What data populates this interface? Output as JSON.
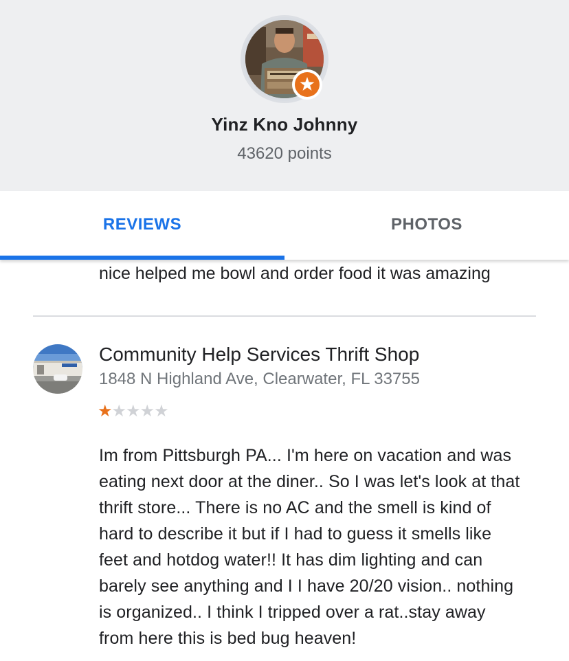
{
  "profile": {
    "name": "Yinz Kno Johnny",
    "points": "43620 points",
    "badge_icon": "local-guide-star-icon",
    "accent": "#e8711b"
  },
  "tabs": {
    "reviews_label": "REVIEWS",
    "photos_label": "PHOTOS",
    "active": "REVIEWS",
    "active_color": "#1a73e8"
  },
  "previous_review": {
    "text_tail": "nice helped me bowl and order food it was amazing"
  },
  "review": {
    "place_name": "Community Help Services Thrift Shop",
    "address": "1848 N Highland Ave, Clearwater, FL 33755",
    "rating": 1,
    "rating_max": 5,
    "text": "Im from Pittsburgh PA... I'm here on vacation and was\neating next door at the diner.. So I was let's look at that\nthrift store...  There is no AC and  the smell is kind of\nhard to describe it but if I had to guess it smells like\nfeet and hotdog water!! It has dim lighting and can\nbarely see anything and I I have 20/20 vision.. nothing\nis organized..  I think I tripped over a rat..stay away\nfrom here this is bed bug heaven!"
  }
}
